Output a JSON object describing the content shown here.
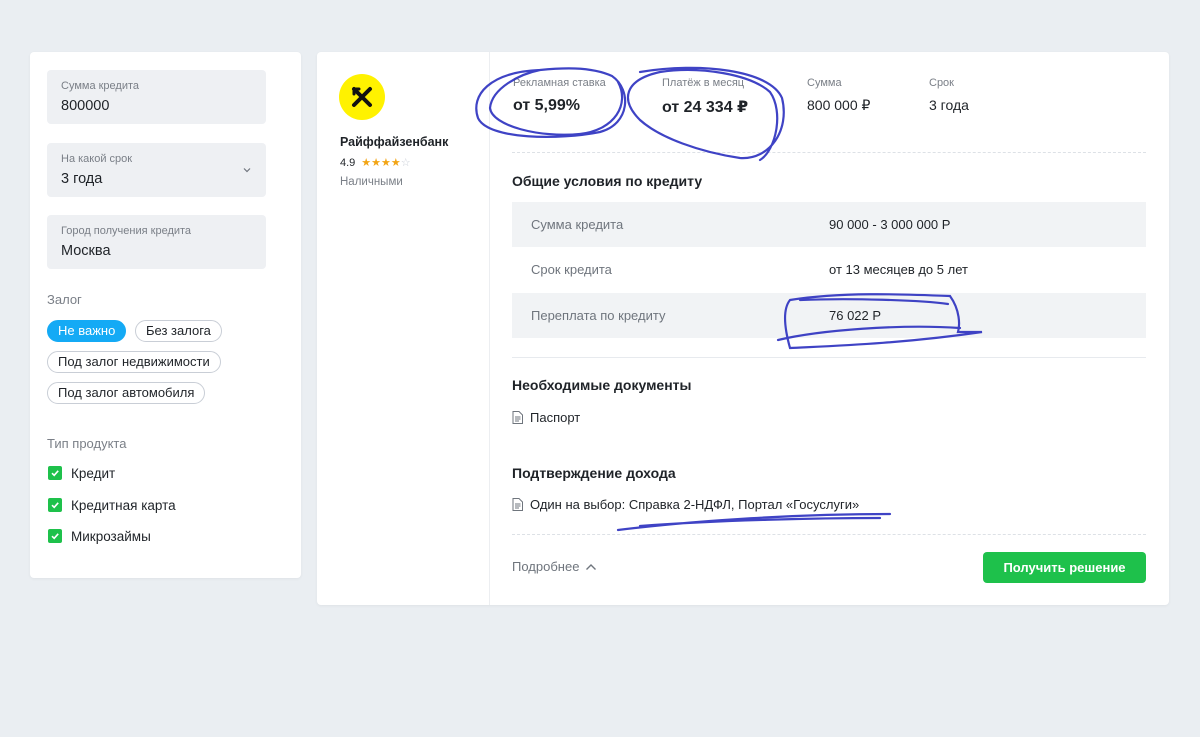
{
  "filters": {
    "amount": {
      "label": "Сумма кредита",
      "value": "800000"
    },
    "term": {
      "label": "На какой срок",
      "value": "3 года"
    },
    "city": {
      "label": "Город получения кредита",
      "value": "Москва"
    },
    "collateral": {
      "label": "Залог",
      "options": [
        "Не важно",
        "Без залога",
        "Под залог недвижимости",
        "Под залог автомобиля"
      ],
      "selected": "Не важно"
    },
    "product_type": {
      "label": "Тип продукта",
      "items": [
        {
          "label": "Кредит",
          "checked": true
        },
        {
          "label": "Кредитная карта",
          "checked": true
        },
        {
          "label": "Микрозаймы",
          "checked": true
        }
      ]
    }
  },
  "offer": {
    "bank": {
      "name": "Райффайзенбанк",
      "rating": "4.9",
      "stars_filled": 4,
      "stars_total": 5,
      "type": "Наличными"
    },
    "stats": [
      {
        "label": "Рекламная ставка",
        "value": "от 5,99%"
      },
      {
        "label": "Платёж в месяц",
        "value": "от 24 334 ₽"
      },
      {
        "label": "Сумма",
        "value": "800 000 ₽"
      },
      {
        "label": "Срок",
        "value": "3 года"
      }
    ],
    "conditions": {
      "title": "Общие условия по кредиту",
      "rows": [
        {
          "key": "Сумма кредита",
          "value": "90 000 - 3 000 000 Р"
        },
        {
          "key": "Срок кредита",
          "value": "от 13 месяцев до 5 лет"
        },
        {
          "key": "Переплата по кредиту",
          "value": "76 022 Р"
        }
      ]
    },
    "documents": {
      "title": "Необходимые документы",
      "items": [
        "Паспорт"
      ]
    },
    "income": {
      "title": "Подтверждение дохода",
      "items": [
        "Один на выбор: Справка 2-НДФЛ, Портал «Госуслуги»"
      ]
    },
    "more_label": "Подробнее",
    "cta_label": "Получить решение"
  },
  "colors": {
    "accent_blue": "#14aaf5",
    "accent_green": "#1ec14b",
    "bank_yellow": "#fff200",
    "star": "#f2a516",
    "annotation_ink": "#2a2fbf"
  }
}
